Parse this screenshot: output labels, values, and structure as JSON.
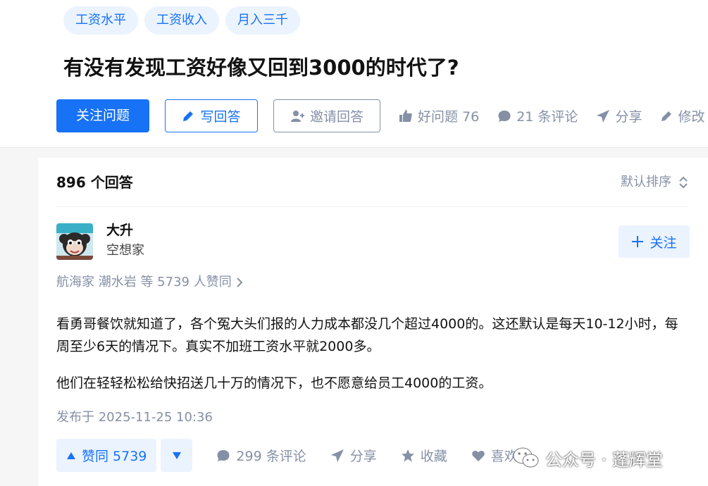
{
  "tags": [
    "工资水平",
    "工资收入",
    "月入三千"
  ],
  "question": {
    "title": "有没有发现工资好像又回到3000的时代了?",
    "follow_label": "关注问题",
    "write_label": "写回答",
    "invite_label": "邀请回答",
    "good_question_label": "好问题 76",
    "comments_label": "21 条评论",
    "share_label": "分享",
    "edit_label": "修改"
  },
  "answers_header": {
    "count_label": "896 个回答",
    "sort_label": "默认排序"
  },
  "answer": {
    "author_name": "大升",
    "author_bio": "空想家",
    "follow_label": "关注",
    "voters_label": "航海家 潮水岩 等 5739 人赞同",
    "paragraphs": [
      "看勇哥餐饮就知道了，各个冤大头们报的人力成本都没几个超过4000的。这还默认是每天10-12小时，每周至少6天的情况下。真实不加班工资水平就2000多。",
      "他们在轻轻松松给快招送几十万的情况下，也不愿意给员工4000的工资。"
    ],
    "publish_time": "发布于 2025-11-25 10:36",
    "vote_up_label": "赞同 5739",
    "comments_label": "299 条评论",
    "share_label": "分享",
    "collect_label": "收藏",
    "like_label": "喜欢"
  },
  "watermark": {
    "text": "公众号 · 蓬辉堂"
  },
  "colors": {
    "accent": "#1772f6",
    "accent_light": "#ebf3ff",
    "muted": "#8590a6"
  }
}
